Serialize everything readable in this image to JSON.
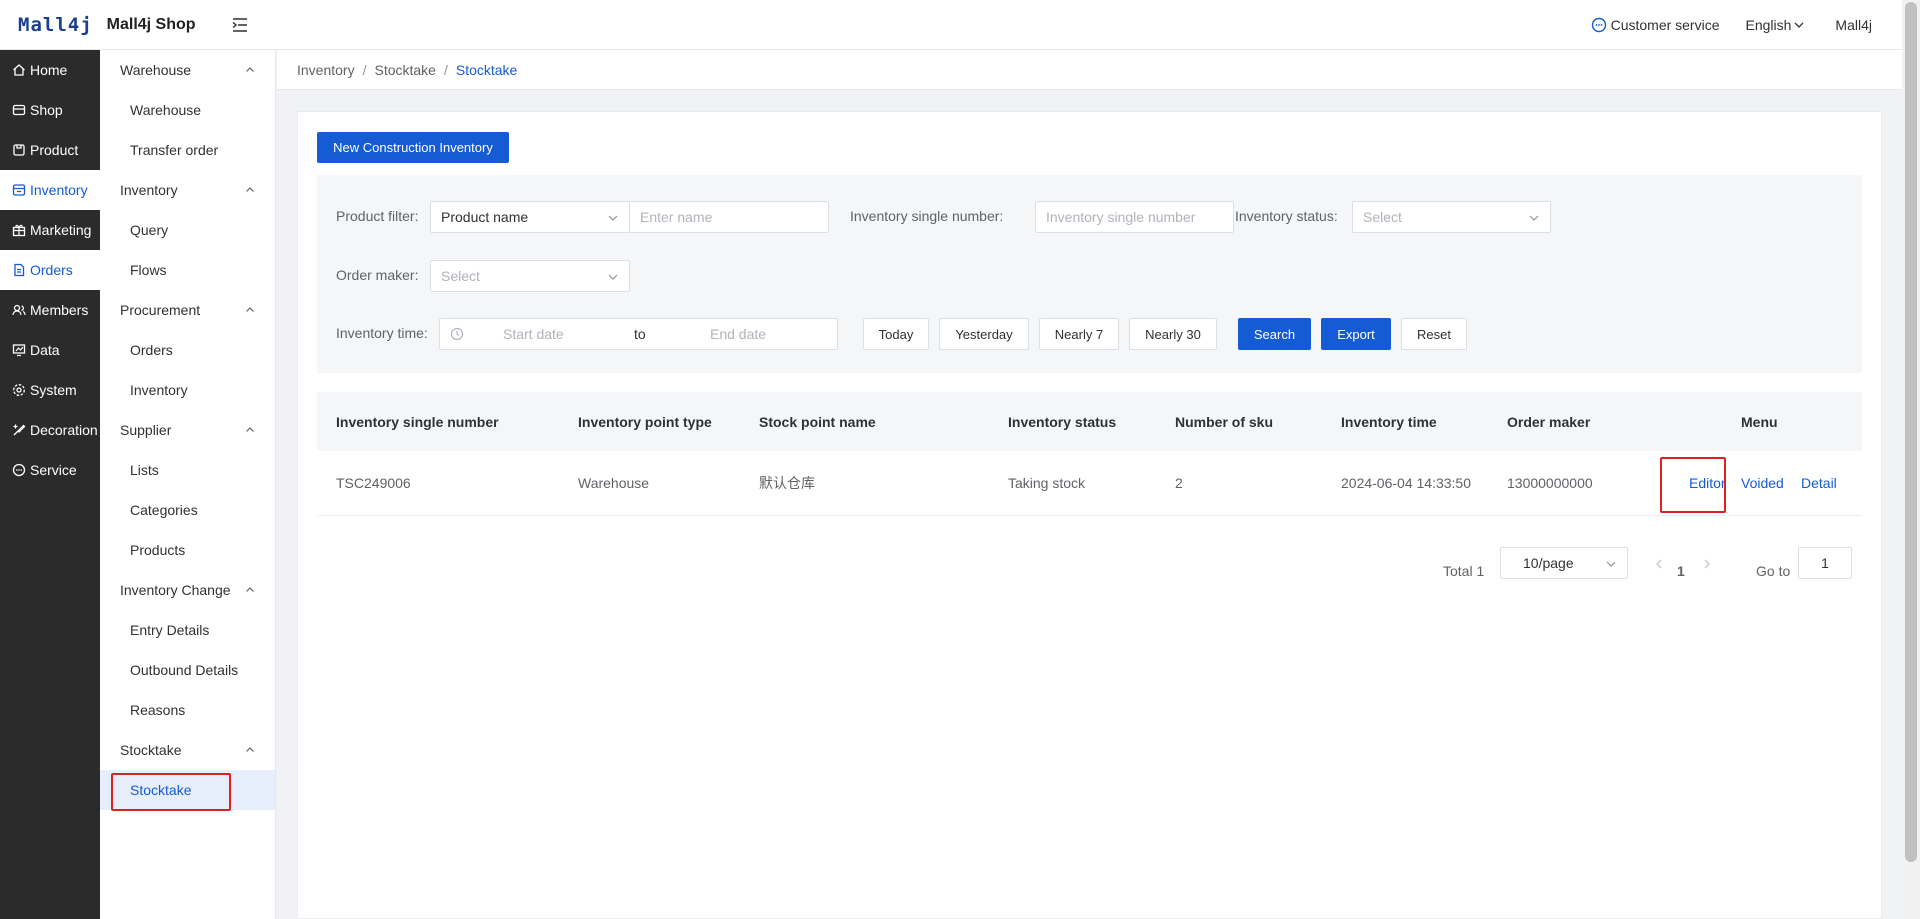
{
  "header": {
    "logo_mark": "Mall4j",
    "app_name": "Mall4j Shop",
    "customer_service": "Customer service",
    "language": "English",
    "user": "Mall4j"
  },
  "main_nav": [
    {
      "label": "Home",
      "icon": "home-icon"
    },
    {
      "label": "Shop",
      "icon": "shop-icon"
    },
    {
      "label": "Product",
      "icon": "product-icon"
    },
    {
      "label": "Inventory",
      "icon": "inventory-icon",
      "active": true
    },
    {
      "label": "Marketing",
      "icon": "gift-icon"
    },
    {
      "label": "Orders",
      "icon": "document-icon"
    },
    {
      "label": "Members",
      "icon": "members-icon"
    },
    {
      "label": "Data",
      "icon": "chart-icon"
    },
    {
      "label": "System",
      "icon": "gear-icon"
    },
    {
      "label": "Decoration",
      "icon": "decoration-icon"
    },
    {
      "label": "Service",
      "icon": "chat-icon"
    }
  ],
  "sub_nav": {
    "groups": [
      {
        "title": "Warehouse",
        "items": [
          "Warehouse",
          "Transfer order"
        ]
      },
      {
        "title": "Inventory",
        "items": [
          "Query",
          "Flows"
        ]
      },
      {
        "title": "Procurement",
        "items": [
          "Orders",
          "Inventory"
        ]
      },
      {
        "title": "Supplier",
        "items": [
          "Lists",
          "Categories",
          "Products"
        ]
      },
      {
        "title": "Inventory Change",
        "items": [
          "Entry Details",
          "Outbound Details",
          "Reasons"
        ]
      },
      {
        "title": "Stocktake",
        "items": [
          "Stocktake"
        ]
      }
    ]
  },
  "breadcrumb": [
    "Inventory",
    "Stocktake",
    "Stocktake"
  ],
  "toolbar": {
    "new_label": "New Construction Inventory"
  },
  "filter": {
    "product_filter_label": "Product filter:",
    "product_filter_select": "Product name",
    "product_name_placeholder": "Enter name",
    "single_number_label": "Inventory single number:",
    "single_number_placeholder": "Inventory single number",
    "status_label": "Inventory status:",
    "status_placeholder": "Select",
    "order_maker_label": "Order maker:",
    "order_maker_placeholder": "Select",
    "time_label": "Inventory time:",
    "start_placeholder": "Start date",
    "range_sep": "to",
    "end_placeholder": "End date",
    "quick": [
      "Today",
      "Yesterday",
      "Nearly 7",
      "Nearly 30"
    ],
    "search": "Search",
    "export": "Export",
    "reset": "Reset"
  },
  "table": {
    "columns": [
      "Inventory single number",
      "Inventory point type",
      "Stock point name",
      "Inventory status",
      "Number of sku",
      "Inventory time",
      "Order maker",
      "Menu"
    ],
    "rows": [
      {
        "number": "TSC249006",
        "point_type": "Warehouse",
        "point_name": "默认仓库",
        "status": "Taking stock",
        "sku": "2",
        "time": "2024-06-04 14:33:50",
        "maker": "13000000000",
        "actions": [
          "Editor",
          "Voided",
          "Detail"
        ]
      }
    ]
  },
  "pagination": {
    "total": "Total 1",
    "page_size": "10/page",
    "current": "1",
    "goto_label": "Go to",
    "goto_value": "1"
  },
  "colors": {
    "accent": "#155bd4",
    "sidebar": "#2b2b2b",
    "highlight": "#e02020"
  }
}
